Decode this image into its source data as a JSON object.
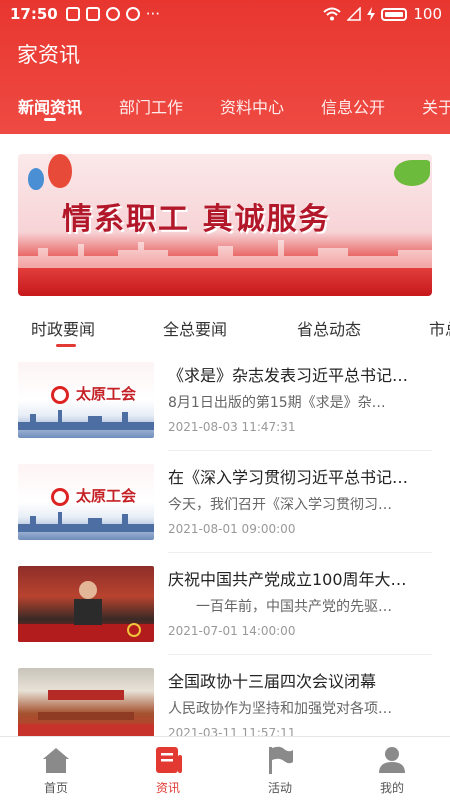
{
  "status_bar": {
    "time": "17:50",
    "more": "···",
    "battery": "100"
  },
  "app_title": "家资讯",
  "top_nav": {
    "items": [
      "新闻资讯",
      "部门工作",
      "资料中心",
      "信息公开",
      "关于"
    ],
    "active": "新闻资讯"
  },
  "banner": {
    "slogan": "情系职工 真诚服务"
  },
  "sub_tabs": {
    "items": [
      "时政要闻",
      "全总要闻",
      "省总动态",
      "市总"
    ],
    "active": "时政要闻"
  },
  "union_name": "太原工会",
  "news": [
    {
      "title": "《求是》杂志发表习近平总书记…",
      "summary": "8月1日出版的第15期《求是》杂…",
      "date": "2021-08-03 11:47:31"
    },
    {
      "title": "在《深入学习贯彻习近平总书记…",
      "summary": "今天，我们召开《深入学习贯彻习…",
      "date": "2021-08-01 09:00:00"
    },
    {
      "title": "庆祝中国共产党成立100周年大…",
      "summary": "　　一百年前，中国共产党的先驱…",
      "date": "2021-07-01 14:00:00"
    },
    {
      "title": "全国政协十三届四次会议闭幕",
      "summary": "人民政协作为坚持和加强党对各项…",
      "date": "2021-03-11 11:57:11"
    }
  ],
  "tab_bar": {
    "items": [
      "首页",
      "资讯",
      "活动",
      "我的"
    ],
    "active": "资讯"
  },
  "colors": {
    "brand_red": "#e8362f",
    "active_tab": "#e23a33"
  }
}
